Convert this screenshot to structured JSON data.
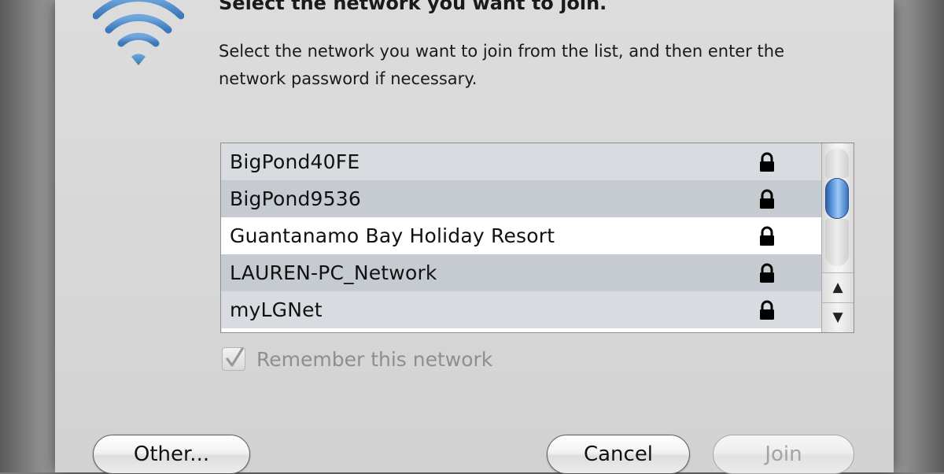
{
  "dialog": {
    "title": "Select the network you want to join.",
    "description": "Select the network you want to join from the list, and then enter the network password if necessary."
  },
  "icons": {
    "app": "wifi-icon",
    "secure": "lock-icon",
    "scroll_up": "chevron-up-icon",
    "scroll_down": "chevron-down-icon",
    "check": "checkmark-icon"
  },
  "networks": [
    {
      "name": "BigPond40FE",
      "secured": true,
      "selected": false
    },
    {
      "name": "BigPond9536",
      "secured": true,
      "selected": false
    },
    {
      "name": "Guantanamo Bay Holiday Resort",
      "secured": true,
      "selected": true
    },
    {
      "name": "LAUREN-PC_Network",
      "secured": true,
      "selected": false
    },
    {
      "name": "myLGNet",
      "secured": true,
      "selected": false
    }
  ],
  "remember": {
    "label": "Remember this network",
    "checked": true,
    "enabled": false
  },
  "buttons": {
    "other": "Other...",
    "cancel": "Cancel",
    "join": "Join",
    "join_enabled": false
  },
  "colors": {
    "wifi_blue": "#4a88c7",
    "scroll_thumb": "#4f8bd8",
    "row_odd": "#d8dbdf",
    "row_even": "#c6cbd2",
    "row_selected": "#ffffff"
  }
}
